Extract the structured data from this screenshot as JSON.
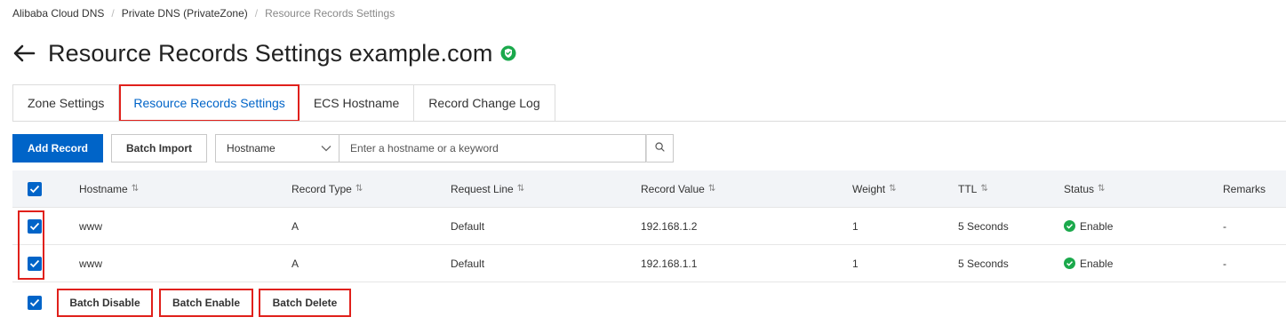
{
  "breadcrumb": {
    "items": [
      "Alibaba Cloud DNS",
      "Private DNS (PrivateZone)",
      "Resource Records Settings"
    ],
    "separator": "/"
  },
  "header": {
    "back_icon": "arrow-left-icon",
    "title": "Resource Records Settings example.com",
    "badge_icon": "verified-shield-icon",
    "badge_color": "#1ba94c"
  },
  "tabs": [
    {
      "label": "Zone Settings",
      "active": false
    },
    {
      "label": "Resource Records Settings",
      "active": true
    },
    {
      "label": "ECS Hostname",
      "active": false
    },
    {
      "label": "Record Change Log",
      "active": false
    }
  ],
  "toolbar": {
    "add_record_label": "Add Record",
    "batch_import_label": "Batch Import",
    "search_select_value": "Hostname",
    "search_placeholder": "Enter a hostname or a keyword",
    "search_icon": "search-icon"
  },
  "table": {
    "columns": [
      "Hostname",
      "Record Type",
      "Request Line",
      "Record Value",
      "Weight",
      "TTL",
      "Status",
      "Remarks"
    ],
    "header_checked": true,
    "rows": [
      {
        "checked": true,
        "hostname": "www",
        "record_type": "A",
        "request_line": "Default",
        "record_value": "192.168.1.2",
        "weight": "1",
        "ttl": "5 Seconds",
        "status": "Enable",
        "remarks": "-"
      },
      {
        "checked": true,
        "hostname": "www",
        "record_type": "A",
        "request_line": "Default",
        "record_value": "192.168.1.1",
        "weight": "1",
        "ttl": "5 Seconds",
        "status": "Enable",
        "remarks": "-"
      }
    ]
  },
  "footer": {
    "select_all_checked": true,
    "batch_disable_label": "Batch Disable",
    "batch_enable_label": "Batch Enable",
    "batch_delete_label": "Batch Delete"
  },
  "colors": {
    "primary": "#0064c8",
    "highlight": "#e0201b",
    "status_ok": "#1ba94c"
  }
}
